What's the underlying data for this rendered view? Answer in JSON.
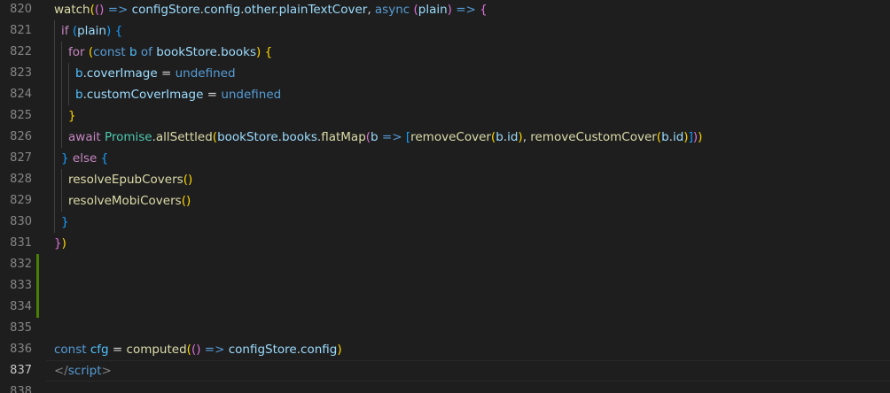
{
  "editor": {
    "language": "vue",
    "current_line": 837,
    "colors": {
      "background": "#1e1e1e",
      "line_number": "#858585",
      "line_number_active": "#c6c6c6",
      "diff_added_gutter": "#487e02",
      "indent_guide": "#404040"
    },
    "lines": [
      {
        "number": "820",
        "indent": 0,
        "added": false,
        "tokens": [
          {
            "t": "watch",
            "c": "fn"
          },
          {
            "t": "(",
            "c": "b1"
          },
          {
            "t": "()",
            "c": "b2"
          },
          {
            "t": " => ",
            "c": "kw"
          },
          {
            "t": "configStore",
            "c": "var"
          },
          {
            "t": ".",
            "c": "op"
          },
          {
            "t": "config",
            "c": "var"
          },
          {
            "t": ".",
            "c": "op"
          },
          {
            "t": "other",
            "c": "var"
          },
          {
            "t": ".",
            "c": "op"
          },
          {
            "t": "plainTextCover",
            "c": "var"
          },
          {
            "t": ", ",
            "c": "op"
          },
          {
            "t": "async",
            "c": "kw"
          },
          {
            "t": " ",
            "c": "op"
          },
          {
            "t": "(",
            "c": "b2"
          },
          {
            "t": "plain",
            "c": "var"
          },
          {
            "t": ")",
            "c": "b2"
          },
          {
            "t": " => ",
            "c": "kw"
          },
          {
            "t": "{",
            "c": "b2"
          }
        ]
      },
      {
        "number": "821",
        "indent": 1,
        "added": false,
        "tokens": [
          {
            "t": "if",
            "c": "ctrl"
          },
          {
            "t": " ",
            "c": "op"
          },
          {
            "t": "(",
            "c": "b3"
          },
          {
            "t": "plain",
            "c": "var"
          },
          {
            "t": ")",
            "c": "b3"
          },
          {
            "t": " ",
            "c": "op"
          },
          {
            "t": "{",
            "c": "b3"
          }
        ]
      },
      {
        "number": "822",
        "indent": 2,
        "added": false,
        "tokens": [
          {
            "t": "for",
            "c": "ctrl"
          },
          {
            "t": " ",
            "c": "op"
          },
          {
            "t": "(",
            "c": "b1"
          },
          {
            "t": "const",
            "c": "kw"
          },
          {
            "t": " ",
            "c": "op"
          },
          {
            "t": "b",
            "c": "const"
          },
          {
            "t": " ",
            "c": "op"
          },
          {
            "t": "of",
            "c": "kw"
          },
          {
            "t": " ",
            "c": "op"
          },
          {
            "t": "bookStore",
            "c": "var"
          },
          {
            "t": ".",
            "c": "op"
          },
          {
            "t": "books",
            "c": "var"
          },
          {
            "t": ")",
            "c": "b1"
          },
          {
            "t": " ",
            "c": "op"
          },
          {
            "t": "{",
            "c": "b1"
          }
        ]
      },
      {
        "number": "823",
        "indent": 3,
        "added": false,
        "tokens": [
          {
            "t": "b",
            "c": "const"
          },
          {
            "t": ".",
            "c": "op"
          },
          {
            "t": "coverImage",
            "c": "var"
          },
          {
            "t": " = ",
            "c": "op"
          },
          {
            "t": "undefined",
            "c": "kw"
          }
        ]
      },
      {
        "number": "824",
        "indent": 3,
        "added": false,
        "tokens": [
          {
            "t": "b",
            "c": "const"
          },
          {
            "t": ".",
            "c": "op"
          },
          {
            "t": "customCoverImage",
            "c": "var"
          },
          {
            "t": " = ",
            "c": "op"
          },
          {
            "t": "undefined",
            "c": "kw"
          }
        ]
      },
      {
        "number": "825",
        "indent": 2,
        "added": false,
        "tokens": [
          {
            "t": "}",
            "c": "b1"
          }
        ]
      },
      {
        "number": "826",
        "indent": 2,
        "added": false,
        "tokens": [
          {
            "t": "await",
            "c": "ctrl"
          },
          {
            "t": " ",
            "c": "op"
          },
          {
            "t": "Promise",
            "c": "type"
          },
          {
            "t": ".",
            "c": "op"
          },
          {
            "t": "allSettled",
            "c": "fn"
          },
          {
            "t": "(",
            "c": "b1"
          },
          {
            "t": "bookStore",
            "c": "var"
          },
          {
            "t": ".",
            "c": "op"
          },
          {
            "t": "books",
            "c": "var"
          },
          {
            "t": ".",
            "c": "op"
          },
          {
            "t": "flatMap",
            "c": "fn"
          },
          {
            "t": "(",
            "c": "b2"
          },
          {
            "t": "b",
            "c": "var"
          },
          {
            "t": " => ",
            "c": "kw"
          },
          {
            "t": "[",
            "c": "b3"
          },
          {
            "t": "removeCover",
            "c": "fn"
          },
          {
            "t": "(",
            "c": "b1"
          },
          {
            "t": "b",
            "c": "var"
          },
          {
            "t": ".",
            "c": "op"
          },
          {
            "t": "id",
            "c": "var"
          },
          {
            "t": ")",
            "c": "b1"
          },
          {
            "t": ", ",
            "c": "op"
          },
          {
            "t": "removeCustomCover",
            "c": "fn"
          },
          {
            "t": "(",
            "c": "b1"
          },
          {
            "t": "b",
            "c": "var"
          },
          {
            "t": ".",
            "c": "op"
          },
          {
            "t": "id",
            "c": "var"
          },
          {
            "t": ")",
            "c": "b1"
          },
          {
            "t": "]",
            "c": "b3"
          },
          {
            "t": ")",
            "c": "b2"
          },
          {
            "t": ")",
            "c": "b1"
          }
        ]
      },
      {
        "number": "827",
        "indent": 1,
        "added": false,
        "tokens": [
          {
            "t": "}",
            "c": "b3"
          },
          {
            "t": " ",
            "c": "op"
          },
          {
            "t": "else",
            "c": "ctrl"
          },
          {
            "t": " ",
            "c": "op"
          },
          {
            "t": "{",
            "c": "b3"
          }
        ]
      },
      {
        "number": "828",
        "indent": 2,
        "added": false,
        "tokens": [
          {
            "t": "resolveEpubCovers",
            "c": "fn"
          },
          {
            "t": "()",
            "c": "b1"
          }
        ]
      },
      {
        "number": "829",
        "indent": 2,
        "added": false,
        "tokens": [
          {
            "t": "resolveMobiCovers",
            "c": "fn"
          },
          {
            "t": "()",
            "c": "b1"
          }
        ]
      },
      {
        "number": "830",
        "indent": 1,
        "added": false,
        "tokens": [
          {
            "t": "}",
            "c": "b3"
          }
        ]
      },
      {
        "number": "831",
        "indent": 0,
        "added": false,
        "tokens": [
          {
            "t": "}",
            "c": "b2"
          },
          {
            "t": ")",
            "c": "b1"
          }
        ]
      },
      {
        "number": "832",
        "indent": 0,
        "added": true,
        "tokens": []
      },
      {
        "number": "833",
        "indent": 0,
        "added": true,
        "tokens": []
      },
      {
        "number": "834",
        "indent": 0,
        "added": true,
        "tokens": []
      },
      {
        "number": "835",
        "indent": 0,
        "added": false,
        "tokens": []
      },
      {
        "number": "836",
        "indent": 0,
        "added": false,
        "tokens": [
          {
            "t": "const",
            "c": "kw"
          },
          {
            "t": " ",
            "c": "op"
          },
          {
            "t": "cfg",
            "c": "const"
          },
          {
            "t": " = ",
            "c": "op"
          },
          {
            "t": "computed",
            "c": "fn"
          },
          {
            "t": "(",
            "c": "b1"
          },
          {
            "t": "()",
            "c": "b2"
          },
          {
            "t": " => ",
            "c": "kw"
          },
          {
            "t": "configStore",
            "c": "var"
          },
          {
            "t": ".",
            "c": "op"
          },
          {
            "t": "config",
            "c": "var"
          },
          {
            "t": ")",
            "c": "b1"
          }
        ]
      },
      {
        "number": "837",
        "indent": 0,
        "added": false,
        "tokens": [
          {
            "t": "</",
            "c": "tag"
          },
          {
            "t": "script",
            "c": "tagname"
          },
          {
            "t": ">",
            "c": "tag"
          }
        ]
      },
      {
        "number": "838",
        "indent": 0,
        "added": false,
        "tokens": []
      }
    ]
  }
}
